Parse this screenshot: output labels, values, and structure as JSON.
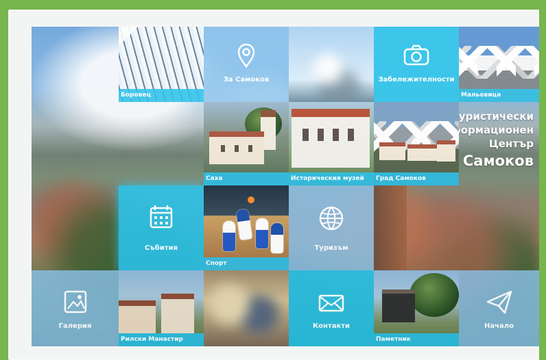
{
  "hero": {
    "line1": "Туристически",
    "line2": "Информационен",
    "line3": "Център",
    "city": "Град Самоков"
  },
  "tiles": {
    "borovets": "Боровец",
    "about": "За Самоков",
    "sights": "Забележителности",
    "malyovitsa": "Мальовица",
    "sakka": "Саха",
    "historical_museum": "Историческия музей",
    "city_samokov": "Град Самоков",
    "events": "Събития",
    "sport": "Спорт",
    "tourism": "Туризъм",
    "gallery": "Галерия",
    "rila_monastery": "Рилски Манастир",
    "contacts": "Контакти",
    "monument": "Паметник",
    "home": "Начало"
  },
  "colors": {
    "outer_background": "#77b54d",
    "accent_blue": "#2ec2e6",
    "light_blue": "#8dc5eb",
    "white": "#ffffff"
  },
  "icons": {
    "location": "location-pin-icon",
    "camera": "camera-icon",
    "calendar": "calendar-icon",
    "globe": "globe-icon",
    "image": "image-icon",
    "mail": "mail-icon",
    "paper_plane": "paper-plane-icon"
  }
}
